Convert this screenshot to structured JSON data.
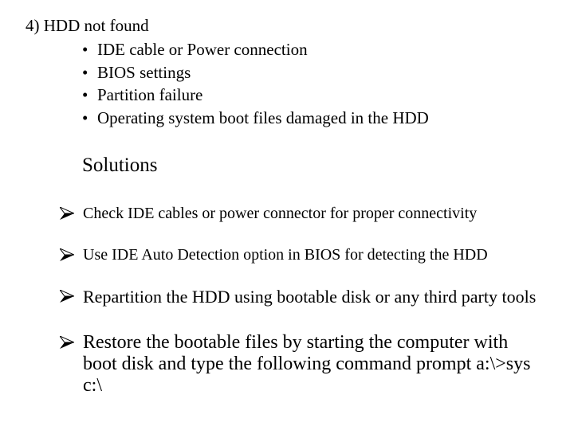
{
  "heading": "4) HDD not found",
  "causes": [
    "IDE cable or Power connection",
    "BIOS settings",
    "Partition failure",
    "Operating system boot files damaged in the HDD"
  ],
  "bullet_glyph": "•",
  "solutions_title": "Solutions",
  "solutions": [
    "Check IDE cables or power connector for proper connectivity",
    "Use IDE Auto Detection option in BIOS for detecting the HDD",
    "Repartition the HDD using bootable disk or any third party tools",
    "Restore the bootable files by starting the computer with boot disk and type the following command prompt a:\\>sys c:\\"
  ],
  "solution_bullet_icon": "arrowhead-icon"
}
